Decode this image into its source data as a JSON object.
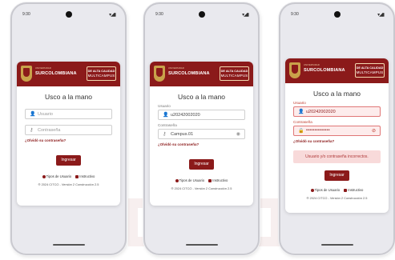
{
  "status": {
    "time": "9:30",
    "icons": "▾◢▮"
  },
  "brand": {
    "name": "SURCOLOMBIANA",
    "sub": "UNIVERSIDAD",
    "badge_line1": "DE ALTA CALIDAD",
    "badge_line2": "MULTICAMPUS"
  },
  "app_title": "Usco a la mano",
  "screens": [
    {
      "user_placeholder": "Usuario",
      "pass_placeholder": "Contraseña"
    },
    {
      "user_label": "Usuario",
      "user_value": "u20242002020",
      "pass_label": "Contraseña",
      "pass_value": "Campus.01"
    },
    {
      "user_label": "Usuario",
      "user_value": "u20242002020",
      "pass_label": "Contraseña",
      "pass_value": "••••••••••••••",
      "alert": "Usuario y/o contraseña incorrectos."
    }
  ],
  "forgot_link": "¿Olvidó su contraseña?",
  "login_button": "Ingresar",
  "links": {
    "user_types": "Tipos de Usuario",
    "instructions": "Instructivo"
  },
  "footer": "® 2024 CITCO - Versión 2 Construcción 2.5",
  "colors": {
    "brand": "#8b1a1a",
    "gold": "#c9a24a",
    "error_bg": "#f8dada"
  }
}
